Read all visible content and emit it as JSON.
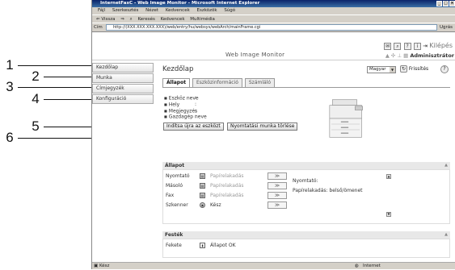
{
  "callouts": [
    "1",
    "2",
    "3",
    "4",
    "5",
    "6"
  ],
  "browser": {
    "title": "InternetFaxC - Web Image Monitor - Microsoft Internet Explorer",
    "menu": [
      "Fájl",
      "Szerkesztés",
      "Nézet",
      "Kedvencek",
      "Eszközök",
      "Súgó"
    ],
    "toolbar": [
      "⇐ Vissza",
      "⇒",
      "Keresés",
      "Kedvencek",
      "Multimédia"
    ],
    "address_label": "Cím",
    "address_value": "http://(XXX.XXX.XXX.XXX)/web/entry/hu/websys/webArch/mainFrame.cgi",
    "go_label": "Ugrás",
    "status_left": "Kész",
    "status_right": "Internet"
  },
  "header": {
    "app_title": "Web Image Monitor",
    "logout": "Kilépés",
    "user": "Adminisztrátor"
  },
  "sidebar": {
    "items": [
      {
        "label": "Kezdőlap"
      },
      {
        "label": "Munka"
      },
      {
        "label": "Címjegyzék"
      },
      {
        "label": "Konfiguráció"
      }
    ]
  },
  "main": {
    "title": "Kezdőlap",
    "language": "Magyar",
    "refresh": "Frissítés",
    "help": "?",
    "tabs": [
      {
        "label": "Állapot",
        "active": true
      },
      {
        "label": "Eszközinformáció",
        "active": false
      },
      {
        "label": "Számláló",
        "active": false
      }
    ],
    "props": [
      {
        "label": "Eszköz neve"
      },
      {
        "label": "Hely"
      },
      {
        "label": "Megjegyzés"
      },
      {
        "label": "Gazdagép neve"
      }
    ],
    "buttons": {
      "restart": "Indítsa újra az eszközt",
      "delete_print_job": "Nyomtatási munka törlése"
    }
  },
  "status_section": {
    "title": "Állapot",
    "devices": [
      {
        "name": "Nyomtató",
        "status": "Papírelakadás",
        "ok": false
      },
      {
        "name": "Másoló",
        "status": "Papírelakadás",
        "ok": false
      },
      {
        "name": "Fax",
        "status": "Papírelakadás",
        "ok": false
      },
      {
        "name": "Szkenner",
        "status": "Kész",
        "ok": true
      }
    ],
    "detail_title": "Nyomtató:",
    "detail_text": "Papírelakadás: belső/ömenet"
  },
  "toner_section": {
    "title": "Festék",
    "color": "Fekete",
    "status": "Állapot OK"
  }
}
